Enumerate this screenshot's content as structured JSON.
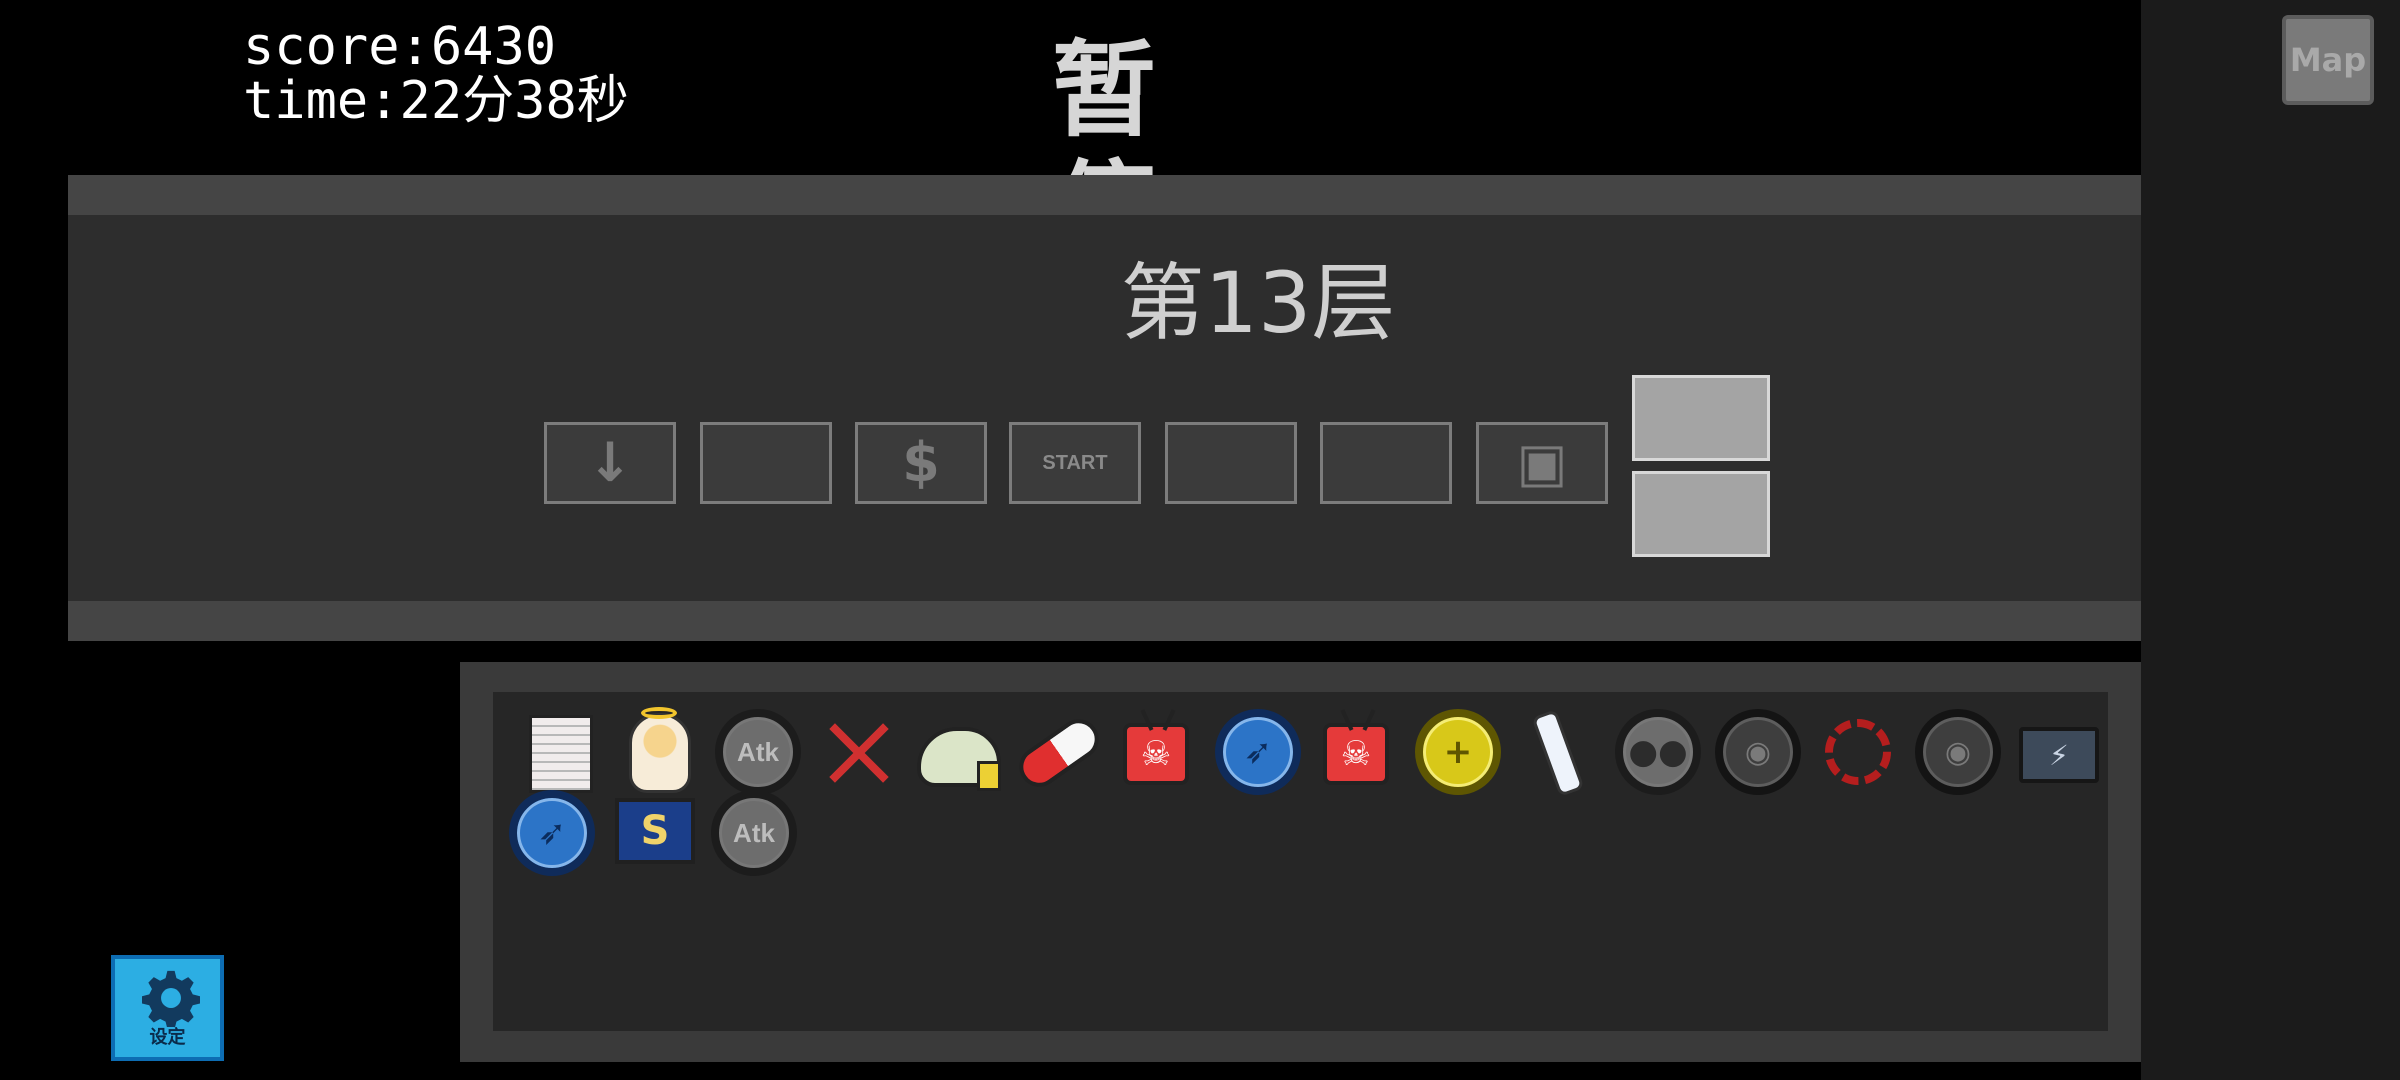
{
  "hud": {
    "score": "score:6430",
    "time": "time:22分38秒",
    "title": "暂停"
  },
  "map_button": {
    "label": "Map"
  },
  "floor": {
    "title": "第13层",
    "rooms": [
      {
        "label": "",
        "icon": "down-arrow-icon"
      },
      {
        "label": ""
      },
      {
        "label": "",
        "icon": "dollar-icon"
      },
      {
        "label": "START"
      },
      {
        "label": ""
      },
      {
        "label": ""
      },
      {
        "label": "",
        "icon": "chest-icon"
      }
    ]
  },
  "items": [
    {
      "name": "scroll-icon"
    },
    {
      "name": "angel-icon"
    },
    {
      "name": "atk-badge-icon",
      "label": "Atk"
    },
    {
      "name": "red-cross-icon"
    },
    {
      "name": "monster-icon"
    },
    {
      "name": "pill-icon"
    },
    {
      "name": "red-tv-skull-icon"
    },
    {
      "name": "blue-bow-badge-icon"
    },
    {
      "name": "red-tv-skull-icon"
    },
    {
      "name": "yellow-badge-icon"
    },
    {
      "name": "spray-bottle-icon"
    },
    {
      "name": "skull-badge-icon"
    },
    {
      "name": "eye-badge-icon"
    },
    {
      "name": "red-spiral-icon"
    },
    {
      "name": "eye-badge-icon"
    },
    {
      "name": "battery-icon"
    },
    {
      "name": "blue-bow-badge-icon"
    },
    {
      "name": "card-icon"
    },
    {
      "name": "atk-badge-icon",
      "label": "Atk"
    }
  ],
  "settings": {
    "label": "设定"
  },
  "colors": {
    "background": "#000000",
    "panel": "#2d2d2d",
    "settings_blue": "#2caee3"
  }
}
